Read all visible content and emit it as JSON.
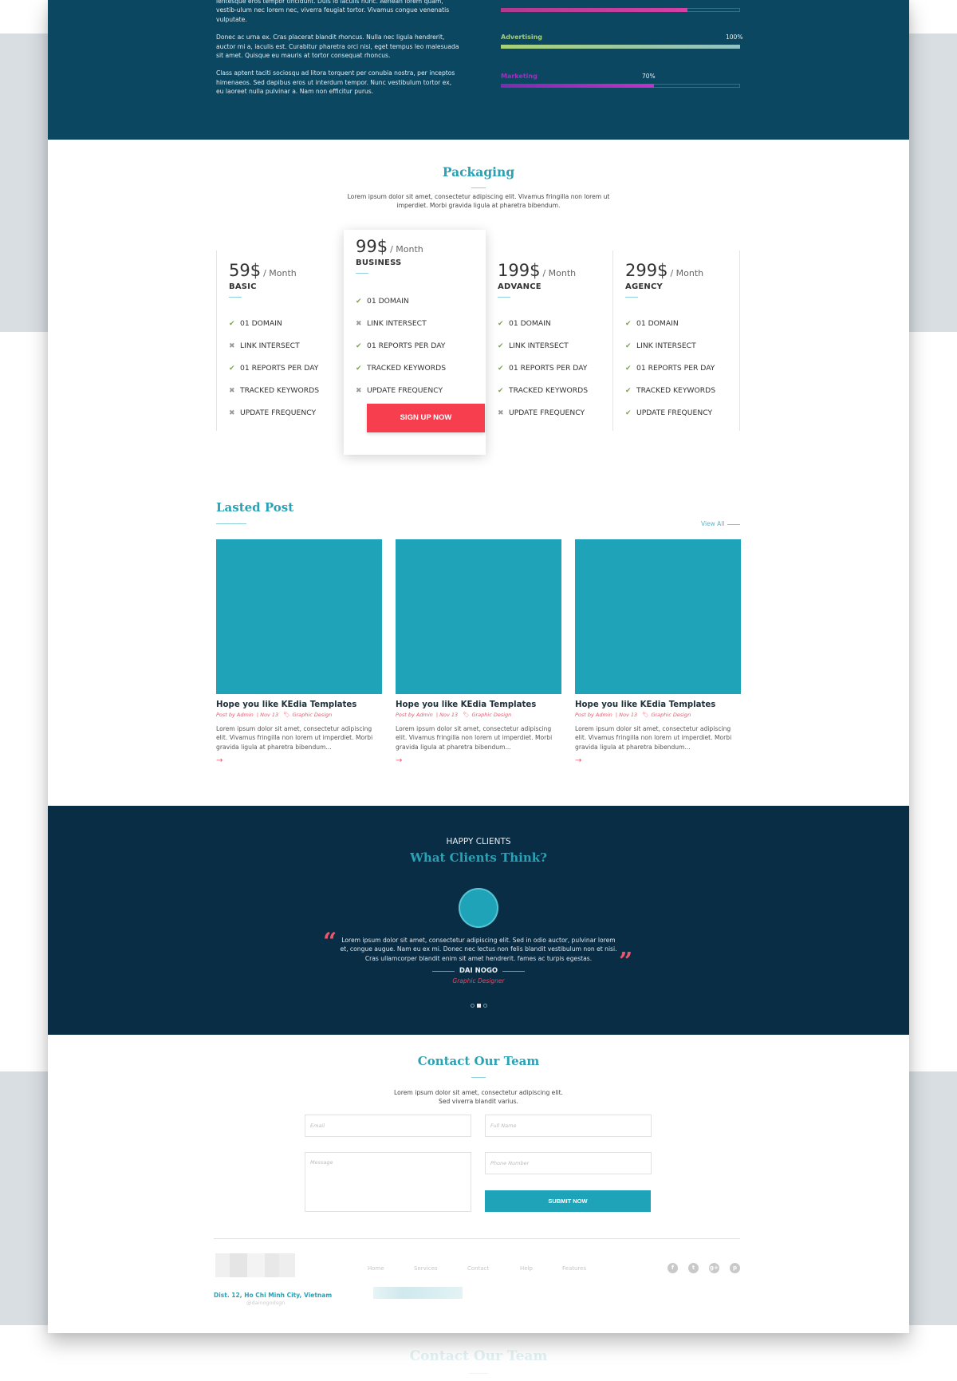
{
  "skills": {
    "paragraphs": [
      "lentesque eros tempor tincidunt. Duis id iaculis nunc. Aenean lorem quam, vestib-ulum nec lorem nec, viverra feugiat tortor. Vivamus congue venenatis vulputate.",
      "Donec ac urna ex. Cras placerat blandit rhoncus. Nulla nec ligula hendrerit, auctor mi a, iaculis est. Curabitur pharetra orci nisi, eget tempus leo malesuada sit amet. Quisque eu mauris at tortor consequat rhoncus.",
      "Class aptent taciti sociosqu ad litora torquent per conubia nostra, per inceptos himenaeos. Sed dapibus eros ut interdum tempor. Nunc vestibulum tortor ex, eu laoreet nulla pulvinar a. Nam non efficitur purus."
    ],
    "bars": [
      {
        "label": "",
        "value_label": "",
        "percent": 78,
        "color_from": "#b03a8e",
        "color_to": "#d63fa6"
      },
      {
        "label": "Advertising",
        "value_label": "100%",
        "percent": 100,
        "color_from": "#a8d277",
        "color_to": "#8fc2c9"
      },
      {
        "label": "Marketing",
        "value_label": "70%",
        "percent": 64,
        "color_from": "#7a2dae",
        "color_to": "#c034c4"
      }
    ]
  },
  "packaging": {
    "title": "Packaging",
    "description_line1": "Lorem ipsum dolor sit amet, consectetur adipiscing elit. Vivamus fringilla non lorem ut",
    "description_line2": "imperdiet. Morbi gravida ligula at pharetra bibendum.",
    "plans": [
      {
        "price": "59$",
        "period": "/ Month",
        "name": "BASIC",
        "featured": false,
        "features": [
          {
            "label": "01 DOMAIN",
            "included": true
          },
          {
            "label": "LINK INTERSECT",
            "included": false
          },
          {
            "label": "01 REPORTS PER DAY",
            "included": true
          },
          {
            "label": "TRACKED KEYWORDS",
            "included": false
          },
          {
            "label": "UPDATE FREQUENCY",
            "included": false
          }
        ]
      },
      {
        "price": "99$",
        "period": "/ Month",
        "name": "BUSINESS",
        "featured": true,
        "cta": "SIGN UP NOW",
        "features": [
          {
            "label": "01 DOMAIN",
            "included": true
          },
          {
            "label": "LINK INTERSECT",
            "included": false
          },
          {
            "label": "01 REPORTS PER DAY",
            "included": true
          },
          {
            "label": "TRACKED KEYWORDS",
            "included": true
          },
          {
            "label": "UPDATE FREQUENCY",
            "included": false
          }
        ]
      },
      {
        "price": "199$",
        "period": "/ Month",
        "name": "ADVANCE",
        "featured": false,
        "features": [
          {
            "label": "01 DOMAIN",
            "included": true
          },
          {
            "label": "LINK INTERSECT",
            "included": true
          },
          {
            "label": "01 REPORTS PER DAY",
            "included": true
          },
          {
            "label": "TRACKED KEYWORDS",
            "included": true
          },
          {
            "label": "UPDATE FREQUENCY",
            "included": false
          }
        ]
      },
      {
        "price": "299$",
        "period": "/ Month",
        "name": "AGENCY",
        "featured": false,
        "features": [
          {
            "label": "01 DOMAIN",
            "included": true
          },
          {
            "label": "LINK INTERSECT",
            "included": true
          },
          {
            "label": "01 REPORTS PER DAY",
            "included": true
          },
          {
            "label": "TRACKED KEYWORDS",
            "included": true
          },
          {
            "label": "UPDATE FREQUENCY",
            "included": true
          }
        ]
      }
    ],
    "icons": {
      "included": "✔",
      "excluded": "✖"
    }
  },
  "posts": {
    "title": "Lasted Post",
    "view_all": "View All",
    "items": [
      {
        "title": "Hope you like KEdia Templates",
        "author": "Post by Admin",
        "date": "Nov 13",
        "category": "Graphic Design",
        "excerpt": "Lorem ipsum dolor sit amet, consectetur adipiscing elit. Vivamus fringilla non lorem ut imperdiet. Morbi gravida ligula at pharetra bibendum...",
        "arrow": "→"
      },
      {
        "title": "Hope you like KEdia Templates",
        "author": "Post by Admin",
        "date": "Nov 13",
        "category": "Graphic Design",
        "excerpt": "Lorem ipsum dolor sit amet, consectetur adipiscing elit. Vivamus fringilla non lorem ut imperdiet. Morbi gravida ligula at pharetra bibendum...",
        "arrow": "→"
      },
      {
        "title": "Hope you like KEdia Templates",
        "author": "Post by Admin",
        "date": "Nov 13",
        "category": "Graphic Design",
        "excerpt": "Lorem ipsum dolor sit amet, consectetur adipiscing elit. Vivamus fringilla non lorem ut imperdiet. Morbi gravida ligula at pharetra bibendum...",
        "arrow": "→"
      }
    ],
    "tag_icon": "🏷"
  },
  "testimonials": {
    "kicker": "HAPPY CLIENTS",
    "title": "What Clients Think?",
    "quote": "Lorem ipsum dolor sit amet, consectetur adipiscing elit. Sed in odio auctor, pulvinar lorem et, congue augue. Nam eu ex mi. Donec nec lectus non felis blandit vestibulum non et nisi. Cras ullamcorper blandit enim sit amet hendrerit. fames ac turpis egestas.",
    "open_quote": "“",
    "close_quote": "”",
    "name": "DAI NOGO",
    "role": "Graphic Designer",
    "slides": 3,
    "active_slide": 2
  },
  "contact": {
    "title": "Contact Our Team",
    "description_line1": "Lorem ipsum dolor sit amet, consectetur adipiscing elit.",
    "description_line2": "Sed viverra blandit varius.",
    "fields": {
      "email_placeholder": "Email",
      "fullname_placeholder": "Full Name",
      "message_placeholder": "Message",
      "phone_placeholder": "Phone Number"
    },
    "submit": "SUBMIT NOW"
  },
  "footer": {
    "nav": [
      "Home",
      "Services",
      "Contact",
      "Help",
      "Features"
    ],
    "address": "Dist. 12, Ho Chi Minh City, Vietnam",
    "handle": "@dainogodsgn",
    "social": [
      {
        "name": "facebook",
        "glyph": "f"
      },
      {
        "name": "twitter",
        "glyph": "t"
      },
      {
        "name": "google-plus",
        "glyph": "g+"
      },
      {
        "name": "pinterest",
        "glyph": "p"
      }
    ]
  },
  "ghost": {
    "title": "Contact Our Team"
  }
}
